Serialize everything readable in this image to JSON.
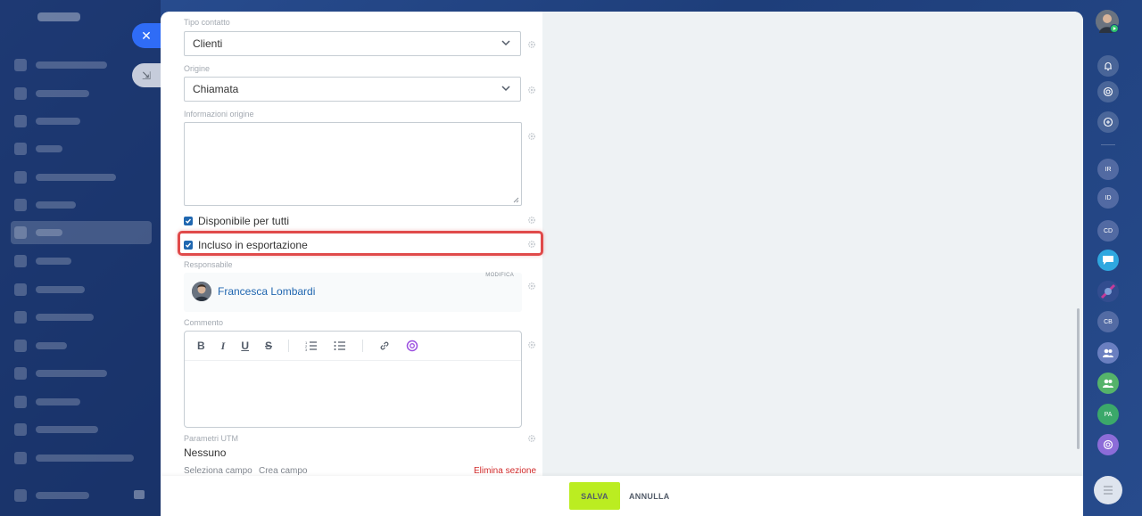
{
  "form": {
    "contact_type": {
      "label": "Tipo contatto",
      "value": "Clienti"
    },
    "source": {
      "label": "Origine",
      "value": "Chiamata"
    },
    "source_info": {
      "label": "Informazioni origine",
      "value": ""
    },
    "available_to_all": {
      "label": "Disponibile per tutti",
      "checked": true
    },
    "included_in_export": {
      "label": "Incluso in esportazione",
      "checked": true
    },
    "responsible": {
      "label": "Responsabile",
      "edit_label": "MODIFICA",
      "name": "Francesca Lombardi"
    },
    "comment": {
      "label": "Commento",
      "toolbar": [
        "B",
        "I",
        "U",
        "S"
      ]
    },
    "utm": {
      "label": "Parametri UTM",
      "value": "Nessuno"
    },
    "links": {
      "select_field": "Seleziona campo",
      "create_field": "Crea campo",
      "delete_section": "Elimina sezione"
    }
  },
  "footer": {
    "save_label": "SALVA",
    "cancel_label": "ANNULLA"
  },
  "rail": {
    "avatars": [
      "IR",
      "ID",
      "CD",
      "CB",
      "PA"
    ]
  },
  "colors": {
    "save_button": "#bbed21",
    "highlight": "#e04a4a",
    "link_blue": "#2066b0",
    "delete_red": "#d12b2b",
    "close_button": "#2f6cf6"
  }
}
